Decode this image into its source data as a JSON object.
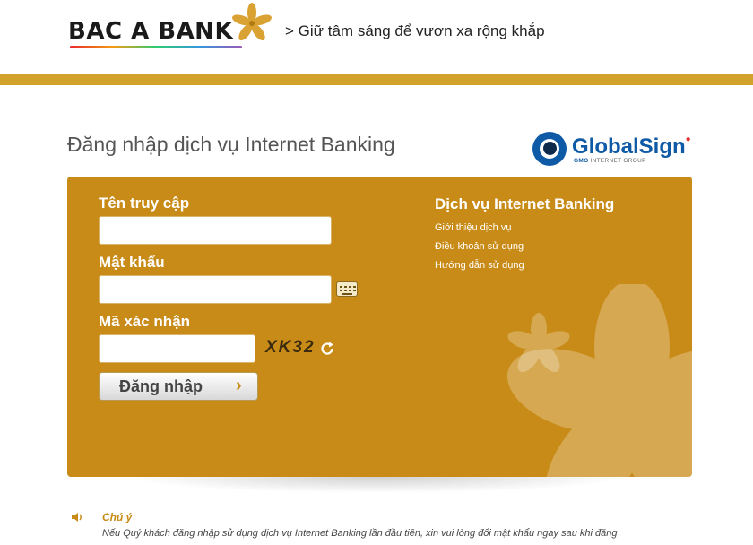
{
  "header": {
    "logo_text": "BAC A BANK",
    "slogan": "> Giữ tâm sáng để vươn xa rộng khắp"
  },
  "page": {
    "title": "Đăng nhập dịch vụ Internet Banking"
  },
  "globalsign": {
    "name": "GlobalSign",
    "sub_brand": "GMO",
    "sub_text": "INTERNET GROUP"
  },
  "login_form": {
    "username_label": "Tên truy cập",
    "username_value": "",
    "password_label": "Mật khẩu",
    "password_value": "",
    "captcha_label": "Mã xác nhận",
    "captcha_value": "",
    "captcha_code": "XK32",
    "submit_label": "Đăng nhập",
    "submit_arrow": "›"
  },
  "services": {
    "title": "Dịch vụ Internet Banking",
    "links": [
      "Giới thiệu dịch vụ",
      "Điều khoản sử dụng",
      "Hướng dẫn sử dụng"
    ]
  },
  "note": {
    "title": "Chú ý",
    "text": "Nếu Quý khách đăng nhập sử dụng dịch vụ Internet Banking lần đầu tiên, xin vui lòng đổi mật khẩu ngay sau khi đăng"
  },
  "colors": {
    "brand_gold": "#c98b17",
    "bar_gold": "#d2a22a",
    "globalsign_blue": "#0e5aa6"
  },
  "icons": [
    "bac-a-bank-flower-icon",
    "globalsign-eye-icon",
    "virtual-keyboard-icon",
    "refresh-icon",
    "speaker-icon"
  ]
}
